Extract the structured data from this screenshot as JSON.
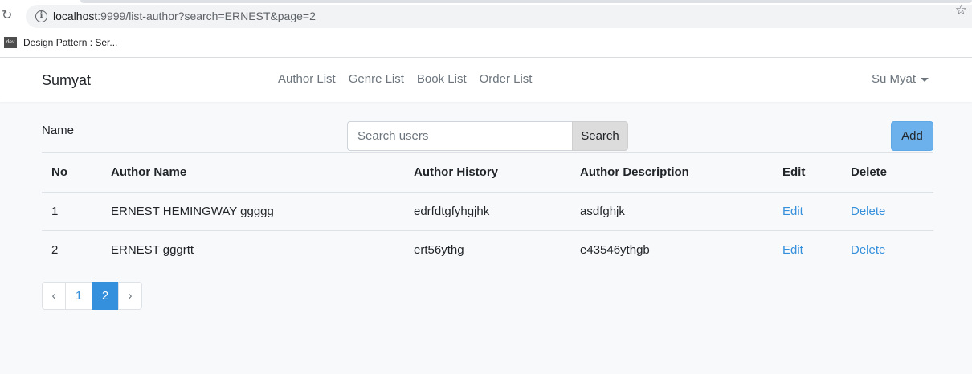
{
  "browser": {
    "url_host": "localhost",
    "url_rest": ":9999/list-author?search=ERNEST&page=2",
    "bookmark_favicon": "dev",
    "bookmark_label": "Design Pattern : Ser..."
  },
  "navbar": {
    "brand": "Sumyat",
    "links": [
      "Author List",
      "Genre List",
      "Book List",
      "Order List"
    ],
    "user": "Su Myat"
  },
  "search": {
    "label": "Name",
    "placeholder": "Search users",
    "button": "Search",
    "add_button": "Add"
  },
  "table": {
    "headers": [
      "No",
      "Author Name",
      "Author History",
      "Author Description",
      "Edit",
      "Delete"
    ],
    "rows": [
      {
        "no": "1",
        "name": "ERNEST HEMINGWAY ggggg",
        "history": "edrfdtgfyhgjhk",
        "description": "asdfghjk",
        "edit": "Edit",
        "delete": "Delete"
      },
      {
        "no": "2",
        "name": "ERNEST gggrtt",
        "history": "ert56ythg",
        "description": "e43546ythgb",
        "edit": "Edit",
        "delete": "Delete"
      }
    ]
  },
  "pagination": {
    "prev": "‹",
    "pages": [
      "1",
      "2"
    ],
    "current": "2",
    "next": "›"
  },
  "colors": {
    "link": "#3490dc",
    "add_button": "#6cb1eb",
    "background": "#f8f9fa"
  }
}
